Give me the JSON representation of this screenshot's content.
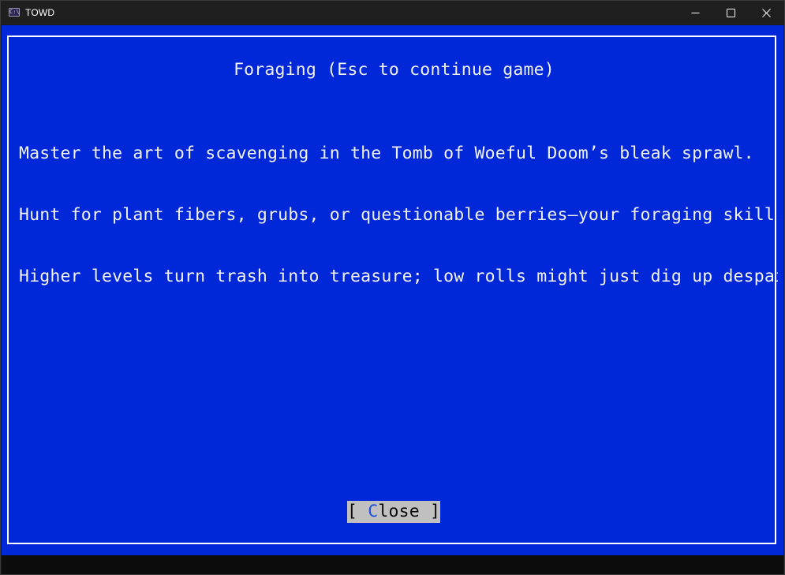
{
  "window": {
    "title": "TOWD",
    "app_icon": "console-app-icon",
    "controls": {
      "minimize": "minimize-icon",
      "maximize": "maximize-icon",
      "close": "close-icon"
    }
  },
  "dialog": {
    "title": "Foraging (Esc to continue game)",
    "lines": [
      "Master the art of scavenging in the Tomb of Woeful Doom’s bleak sprawl.",
      "Hunt for plant fibers, grubs, or questionable berries—your foraging skill",
      "Higher levels turn trash into treasure; low rolls might just dig up despai"
    ],
    "close_button": {
      "open_bracket": "[ ",
      "hotkey": "C",
      "rest": "lose",
      "close_bracket": " ]"
    }
  },
  "colors": {
    "terminal_background": "#0028d8",
    "text": "#f2f2f2",
    "button_background": "#c0c0c0",
    "hotkey": "#1f4fd8"
  }
}
